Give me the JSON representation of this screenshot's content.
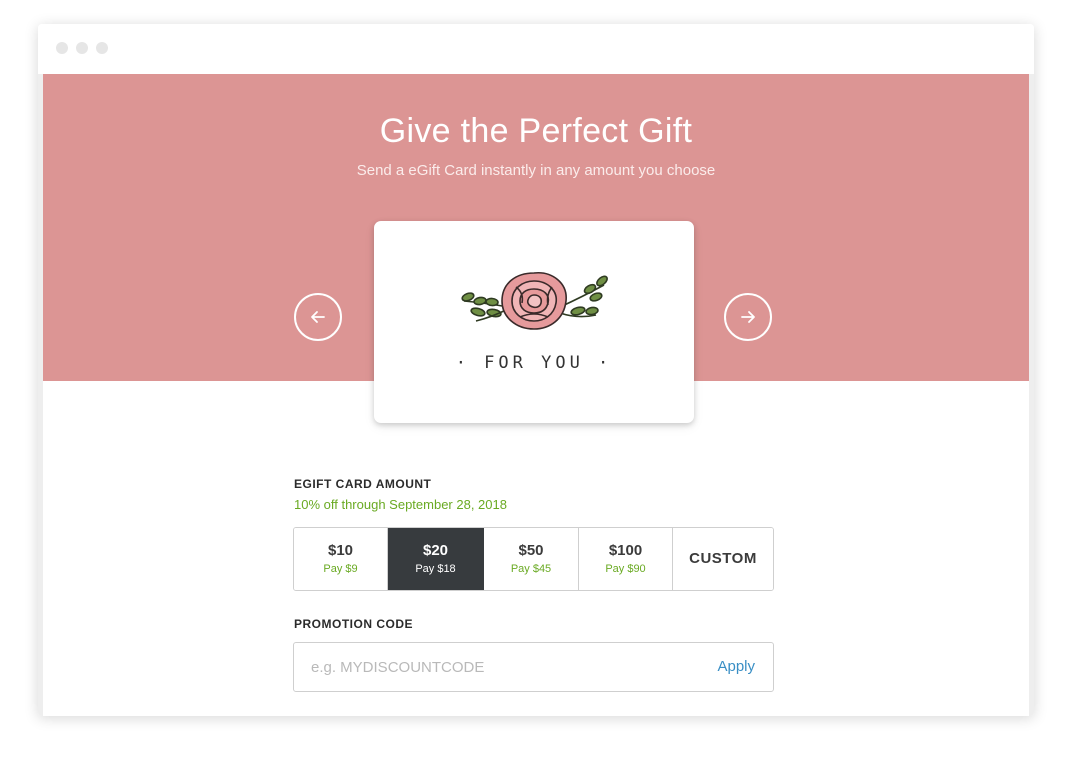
{
  "window": {
    "controls": [
      "dot",
      "dot",
      "dot"
    ]
  },
  "hero": {
    "title": "Give the Perfect Gift",
    "subtitle": "Send a eGift Card instantly in any amount you choose",
    "background_color": "#dc9594",
    "prev_icon": "arrow-left-icon",
    "next_icon": "arrow-right-icon"
  },
  "card": {
    "illustration": "rose-illustration",
    "text": "· FOR YOU ·"
  },
  "amount": {
    "label": "EGIFT CARD AMOUNT",
    "promo_note": "10% off through September 28, 2018",
    "options": [
      {
        "value": "$10",
        "pay": "Pay $9"
      },
      {
        "value": "$20",
        "pay": "Pay $18"
      },
      {
        "value": "$50",
        "pay": "Pay $45"
      },
      {
        "value": "$100",
        "pay": "Pay $90"
      },
      {
        "value": "CUSTOM"
      }
    ],
    "selected": "$20",
    "accent_color": "#6aaa23",
    "selected_color": "#373b3e"
  },
  "promotion": {
    "label": "PROMOTION CODE",
    "placeholder": "e.g. MYDISCOUNTCODE",
    "apply_label": "Apply",
    "link_color": "#3a8fc5"
  }
}
